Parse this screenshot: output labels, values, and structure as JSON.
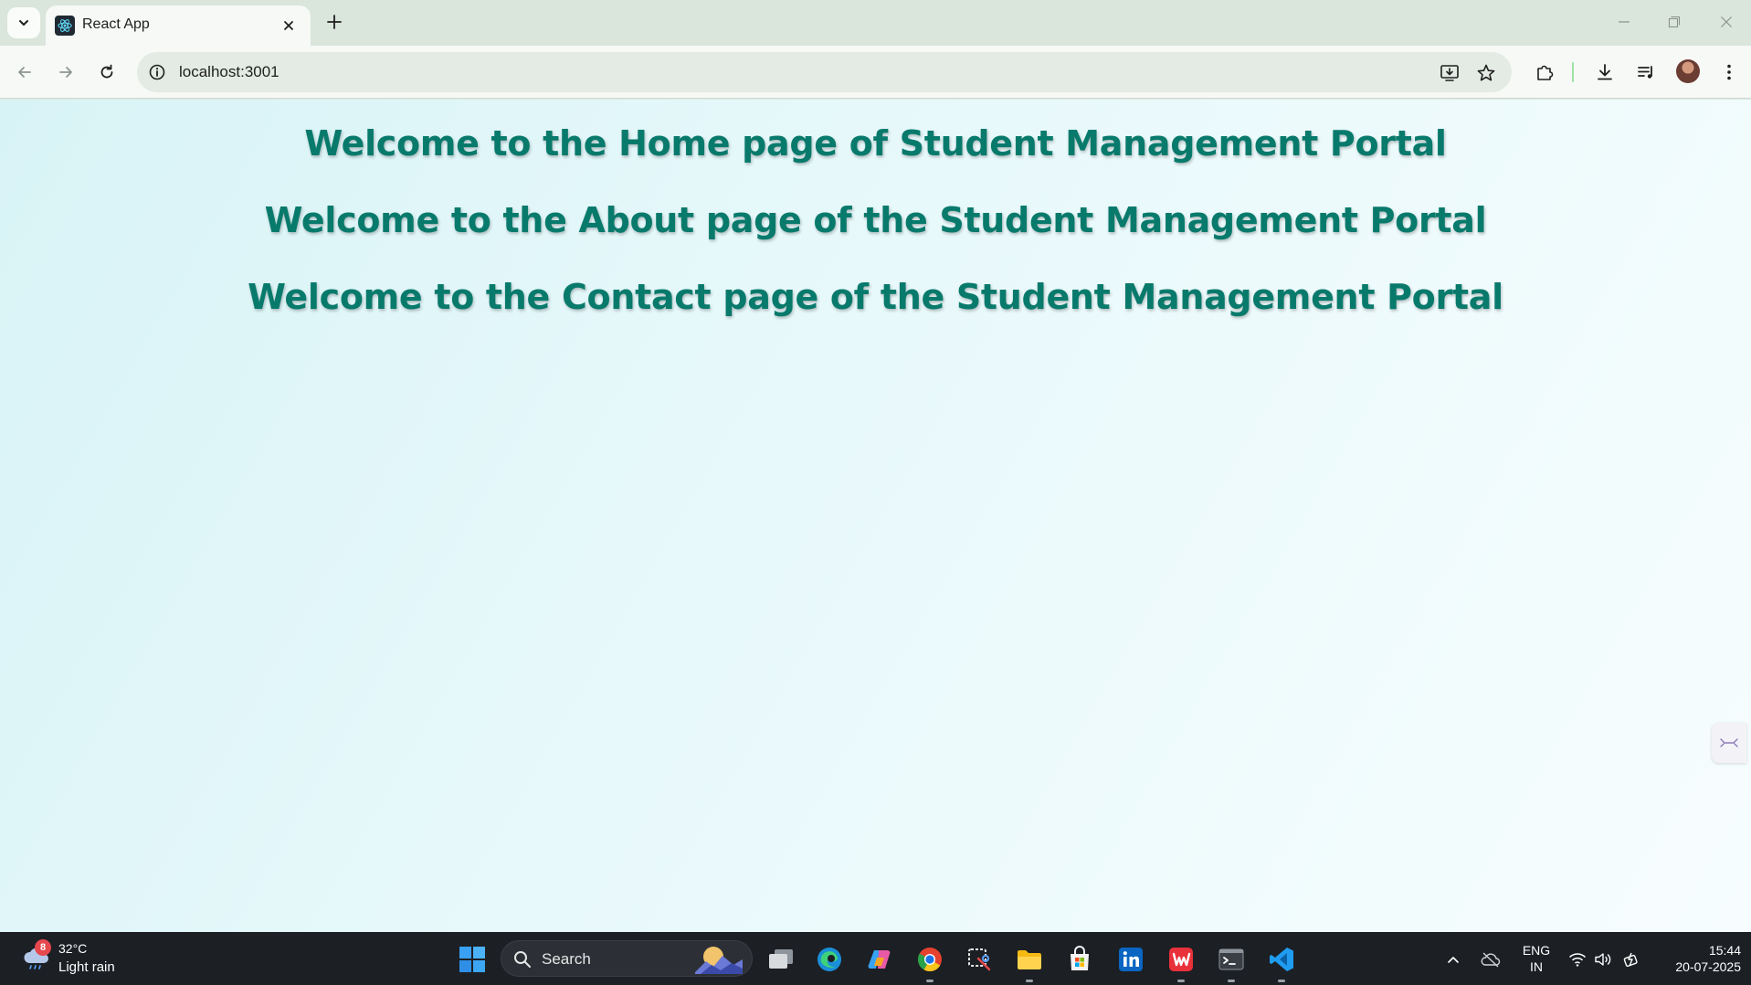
{
  "browser": {
    "tab": {
      "title": "React App"
    },
    "address_bar": {
      "url": "localhost:3001"
    }
  },
  "page": {
    "headings": [
      "Welcome to the Home page of Student Management Portal",
      "Welcome to the About page of the Student Management Portal",
      "Welcome to the Contact page of the Student Management Portal"
    ],
    "heading_color": "#087a6c"
  },
  "taskbar": {
    "weather": {
      "badge": "8",
      "temperature": "32°C",
      "condition": "Light rain"
    },
    "search": {
      "label": "Search"
    },
    "language": {
      "line1": "ENG",
      "line2": "IN"
    },
    "clock": {
      "time": "15:44",
      "date": "20-07-2025"
    }
  }
}
